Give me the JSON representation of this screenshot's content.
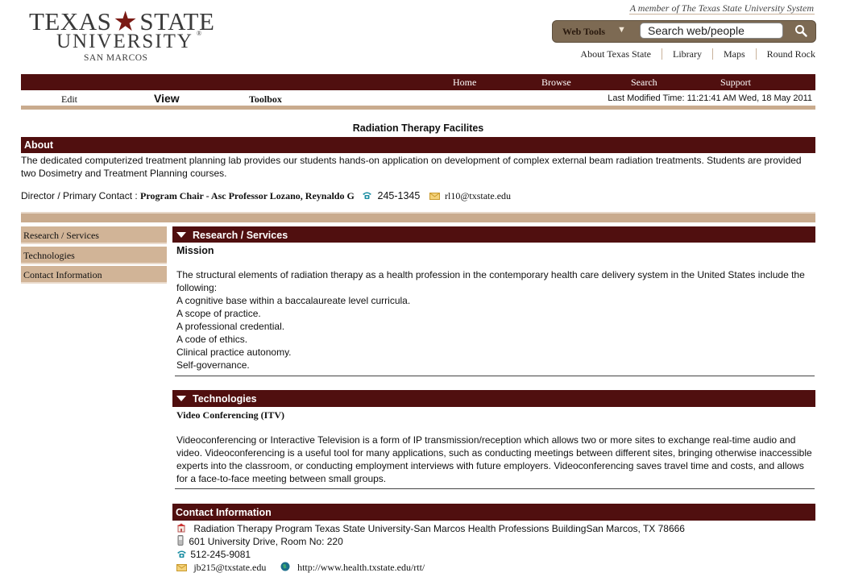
{
  "header": {
    "logo": {
      "line1_a": "TEXAS",
      "line1_b": "STATE",
      "line2": "UNIVERSITY",
      "registered": "®",
      "line3": "SAN MARCOS"
    },
    "member_text": "A member of The Texas State University System",
    "web_tools_label": "Web Tools",
    "search_value": "Search web/people",
    "top_links": [
      "About Texas State",
      "Library",
      "Maps",
      "Round Rock"
    ]
  },
  "nav": {
    "items": [
      "Home",
      "Browse",
      "Search",
      "Support"
    ],
    "edit": "Edit",
    "view": "View",
    "toolbox": "Toolbox",
    "last_modified": "Last Modified Time: 11:21:41 AM Wed, 18 May 2011"
  },
  "page": {
    "title": "Radiation Therapy Facilites",
    "about": {
      "heading": "About",
      "text": "The dedicated computerized treatment planning lab provides our students hands-on application on development of complex external beam radiation treatments. Students are provided two Dosimetry and Treatment Planning courses.",
      "contact_label": "Director / Primary Contact :",
      "contact_name": "Program Chair - Asc Professor Lozano, Reynaldo G",
      "phone": "245-1345",
      "email": "rl10@txstate.edu"
    }
  },
  "sidebar": {
    "items": [
      "Research / Services",
      "Technologies",
      "Contact Information"
    ]
  },
  "research": {
    "heading": "Research / Services",
    "subheading": "Mission",
    "intro": "The structural elements of radiation therapy as a health profession in the contemporary health care delivery system in the United States include the following:",
    "list": [
      "A cognitive base within a baccalaureate level curricula.",
      "A scope of practice.",
      "A professional credential.",
      "A code of ethics.",
      "Clinical practice autonomy.",
      "Self-governance."
    ]
  },
  "technologies": {
    "heading": "Technologies",
    "subheading": "Video Conferencing (ITV)",
    "text": "Videoconferencing or Interactive Television is a form of IP transmission/reception which allows two or more sites to exchange real-time audio and video. Videoconferencing is a useful tool for many applications, such as conducting meetings between different sites, bringing otherwise inaccessible experts into the classroom, or conducting employment interviews with future employers. Videoconferencing saves travel time and costs, and allows for a face-to-face meeting between small groups."
  },
  "contact": {
    "heading": "Contact Information",
    "address": "Radiation Therapy Program Texas State University-San Marcos Health Professions BuildingSan Marcos, TX 78666",
    "room": "601 University Drive, Room No: 220",
    "phone": "512-245-9081",
    "email": "jb215@txstate.edu",
    "website": "http://www.health.txstate.edu/rtt/"
  },
  "colors": {
    "maroon": "#500f0f",
    "tan": "#c9ab8e",
    "sidebar_tan": "#d1b497",
    "webtools_brown": "#7d6a53"
  },
  "icons": [
    "star-icon",
    "chevron-down-icon",
    "search-icon",
    "phone-icon",
    "envelope-icon",
    "building-icon",
    "mobile-icon",
    "globe-icon",
    "triangle-down-icon"
  ]
}
